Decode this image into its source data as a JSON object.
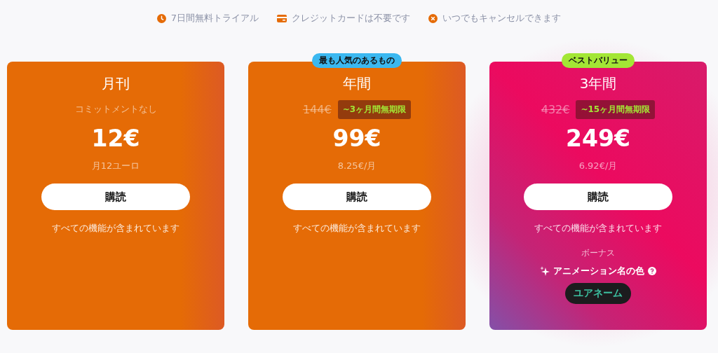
{
  "perks": [
    {
      "kind": "clock",
      "label": "7日間無料トライアル"
    },
    {
      "kind": "card",
      "label": "クレジットカードは不要です"
    },
    {
      "kind": "cancel",
      "label": "いつでもキャンセルできます"
    }
  ],
  "plans": [
    {
      "color": "#e56b06",
      "name": "月刊",
      "note": "コミットメントなし",
      "price": "12€",
      "per_month": "月12ユーロ",
      "button": "購読",
      "features": "すべての機能が含まれています"
    },
    {
      "color": "#e56b06",
      "badge": {
        "label": "最も人気のあるもの",
        "color": "#3bb8f0"
      },
      "name": "年間",
      "old_price": "144€",
      "discount": "~3ヶ月間無期限",
      "price": "99€",
      "per_month": "8.25€/月",
      "button": "購読",
      "features": "すべての機能が含まれています"
    },
    {
      "color": "#ec0a5f",
      "badge": {
        "label": "ベストバリュー",
        "color": "#a3e635"
      },
      "name": "3年間",
      "old_price": "432€",
      "discount": "~15ヶ月間無期限",
      "price": "249€",
      "per_month": "6.92€/月",
      "button": "購読",
      "features": "すべての機能が含まれています",
      "bonus": {
        "title": "ボーナス",
        "perk": "アニメーション名の色",
        "sample": "ユアネーム"
      }
    }
  ]
}
